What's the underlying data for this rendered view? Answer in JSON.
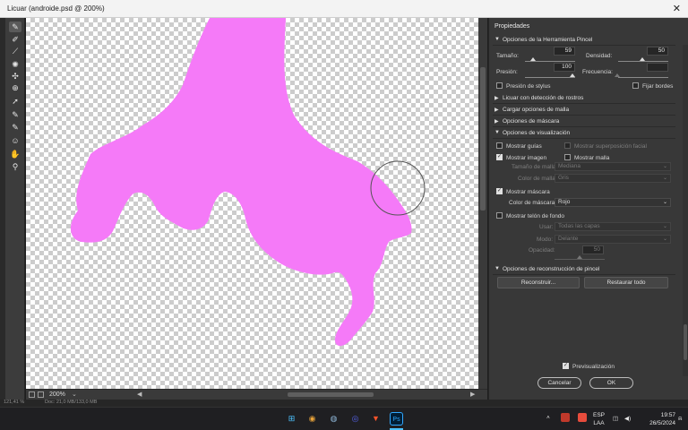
{
  "window": {
    "title": "Licuar (androide.psd @ 200%)",
    "close": "✕"
  },
  "tools": [
    {
      "name": "forward-warp-icon",
      "glyph": "✎"
    },
    {
      "name": "reconstruct-icon",
      "glyph": "✐"
    },
    {
      "name": "smooth-icon",
      "glyph": "⟋"
    },
    {
      "name": "twirl-icon",
      "glyph": "✺"
    },
    {
      "name": "pucker-icon",
      "glyph": "✣"
    },
    {
      "name": "bloat-icon",
      "glyph": "⊕"
    },
    {
      "name": "push-left-icon",
      "glyph": "➚"
    },
    {
      "name": "freeze-mask-icon",
      "glyph": "✎"
    },
    {
      "name": "thaw-mask-icon",
      "glyph": "✎"
    },
    {
      "name": "face-tool-icon",
      "glyph": "☺"
    },
    {
      "name": "hand-icon",
      "glyph": "✋"
    },
    {
      "name": "zoom-icon",
      "glyph": "⚲"
    }
  ],
  "canvas": {
    "zoom": "200%",
    "status": "Doc: 21,0 MB/133,0 MB",
    "pos": "121,41 %"
  },
  "panel": {
    "title": "Propiedades",
    "brush": {
      "header": "Opciones de la Herramienta Pincel",
      "size_label": "Tamaño:",
      "size_value": "59",
      "density_label": "Densidad:",
      "density_value": "50",
      "pressure_label": "Presión:",
      "pressure_value": "100",
      "rate_label": "Frecuencia:",
      "rate_value": "",
      "stylus_label": "Presión de stylus",
      "pin_edges_label": "Fijar bordes"
    },
    "collapsed": [
      "Licuar con detección de rostros",
      "Cargar opciones de malla",
      "Opciones de máscara"
    ],
    "view": {
      "header": "Opciones de visualización",
      "show_guides": "Mostrar guías",
      "show_face_overlay": "Mostrar superposición facial",
      "show_image": "Mostrar imagen",
      "show_mesh": "Mostrar malla",
      "mesh_size_label": "Tamaño de malla:",
      "mesh_size_value": "Mediana",
      "mesh_color_label": "Color de malla:",
      "mesh_color_value": "Gris",
      "show_mask": "Mostrar máscara",
      "mask_color_label": "Color de máscara:",
      "mask_color_value": "Rojo",
      "show_backdrop": "Mostrar telón de fondo",
      "use_label": "Usar:",
      "use_value": "Todas las capas",
      "mode_label": "Modo:",
      "mode_value": "Delante",
      "opacity_label": "Opacidad:",
      "opacity_value": "50"
    },
    "reconstruct": {
      "header": "Opciones de reconstrucción de pincel",
      "reconstruct_btn": "Reconstruir...",
      "restore_btn": "Restaurar todo"
    },
    "preview_label": "Previsualización",
    "cancel": "Cancelar",
    "ok": "OK"
  },
  "taskbar": {
    "lang": "ESP",
    "lang2": "LAA",
    "time": "19:57",
    "date": "26/5/2024",
    "apps": [
      {
        "name": "windows-start-icon",
        "glyph": "⊞",
        "color": "#4cc2ff"
      },
      {
        "name": "chrome-icon",
        "glyph": "◉",
        "color": "#e8a33a"
      },
      {
        "name": "steam-icon",
        "glyph": "◍",
        "color": "#8fb7d8"
      },
      {
        "name": "discord-icon",
        "glyph": "◎",
        "color": "#5865f2"
      },
      {
        "name": "brave-icon",
        "glyph": "▼",
        "color": "#fb542b"
      },
      {
        "name": "photoshop-icon",
        "glyph": "Ps",
        "color": "#31a8ff"
      }
    ]
  },
  "colors": {
    "mask": "#f57af8",
    "accent": "#31a8ff"
  }
}
